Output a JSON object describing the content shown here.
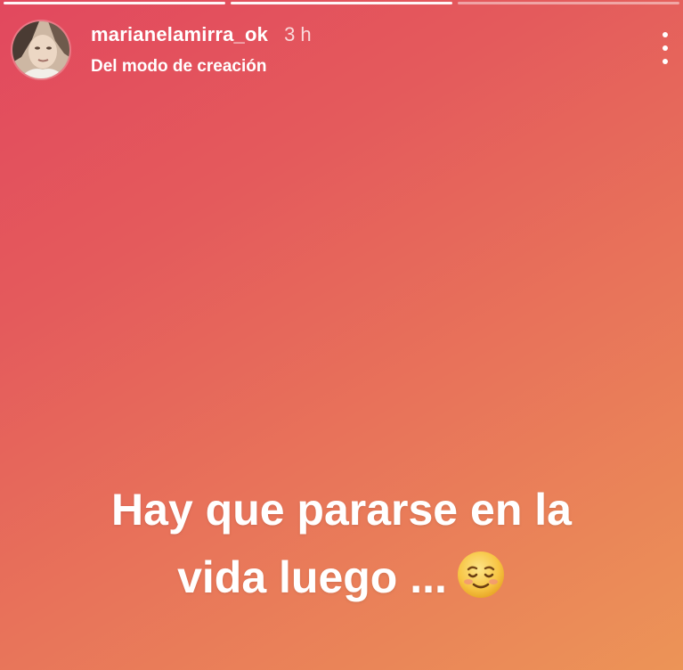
{
  "story": {
    "progress_segments": 3,
    "active_segment": 2,
    "username": "marianelamirra_ok",
    "time": "3 h",
    "subtitle": "Del modo de creación",
    "caption_line1": "Hay que pararse en la",
    "caption_line2": "vida luego ...",
    "emoji_icon": "smiling-face-icon",
    "menu_icon": "more-vertical-icon",
    "background_colors": [
      "#e2485e",
      "#e8735a",
      "#ec9457"
    ]
  }
}
